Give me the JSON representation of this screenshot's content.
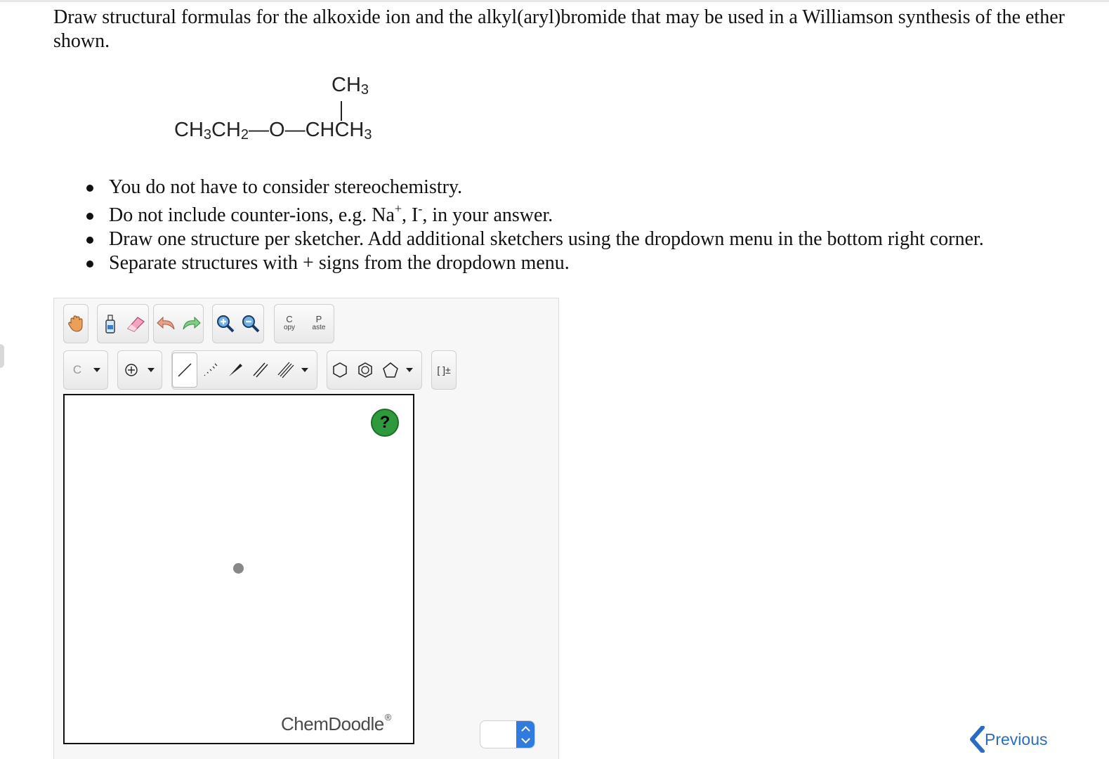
{
  "question": {
    "text": "Draw structural formulas for the alkoxide ion and the alkyl(aryl)bromide that may be used in a Williamson synthesis of the ether shown."
  },
  "molecule": {
    "top_group": "CH",
    "top_sub": "3",
    "chain": [
      {
        "t": "CH"
      },
      {
        "s": "3"
      },
      {
        "t": "CH"
      },
      {
        "s": "2"
      },
      {
        "t": "—O—CHCH"
      },
      {
        "s": "3"
      }
    ]
  },
  "bullets": {
    "b1": "You do not have to consider stereochemistry.",
    "b2_pre": "Do not include counter-ions, e.g. Na",
    "b2_sup1": "+",
    "b2_mid": ", I",
    "b2_sup2": "-",
    "b2_post": ", in your answer.",
    "b3": "Draw one structure per sketcher. Add additional sketchers using the dropdown menu in the bottom right corner.",
    "b4": "Separate structures with + signs from the dropdown menu."
  },
  "toolbar": {
    "copy_big": "C",
    "copy_small": "opy",
    "paste_big": "P",
    "paste_small": "aste",
    "element_label": "C",
    "bracket_label": "[ ]±"
  },
  "sketcher": {
    "help_label": "?",
    "brand": "ChemDoodle",
    "brand_mark": "®"
  },
  "nav": {
    "previous_label": "Previous"
  },
  "colors": {
    "accent_blue": "#2f7be0",
    "help_green": "#2f9a3c",
    "link_blue": "#2a6cc4"
  }
}
